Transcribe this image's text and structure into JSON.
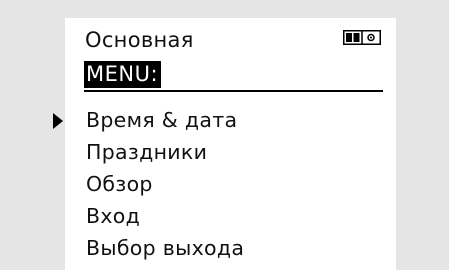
{
  "header": {
    "title": "Основная",
    "mode_icon": "split-screen-icon"
  },
  "menu": {
    "label": "MENU:",
    "selected_index": 0,
    "items": [
      {
        "label": "Время & дата"
      },
      {
        "label": "Праздники"
      },
      {
        "label": "Обзор"
      },
      {
        "label": "Вход"
      },
      {
        "label": "Выбор выхода"
      }
    ]
  }
}
